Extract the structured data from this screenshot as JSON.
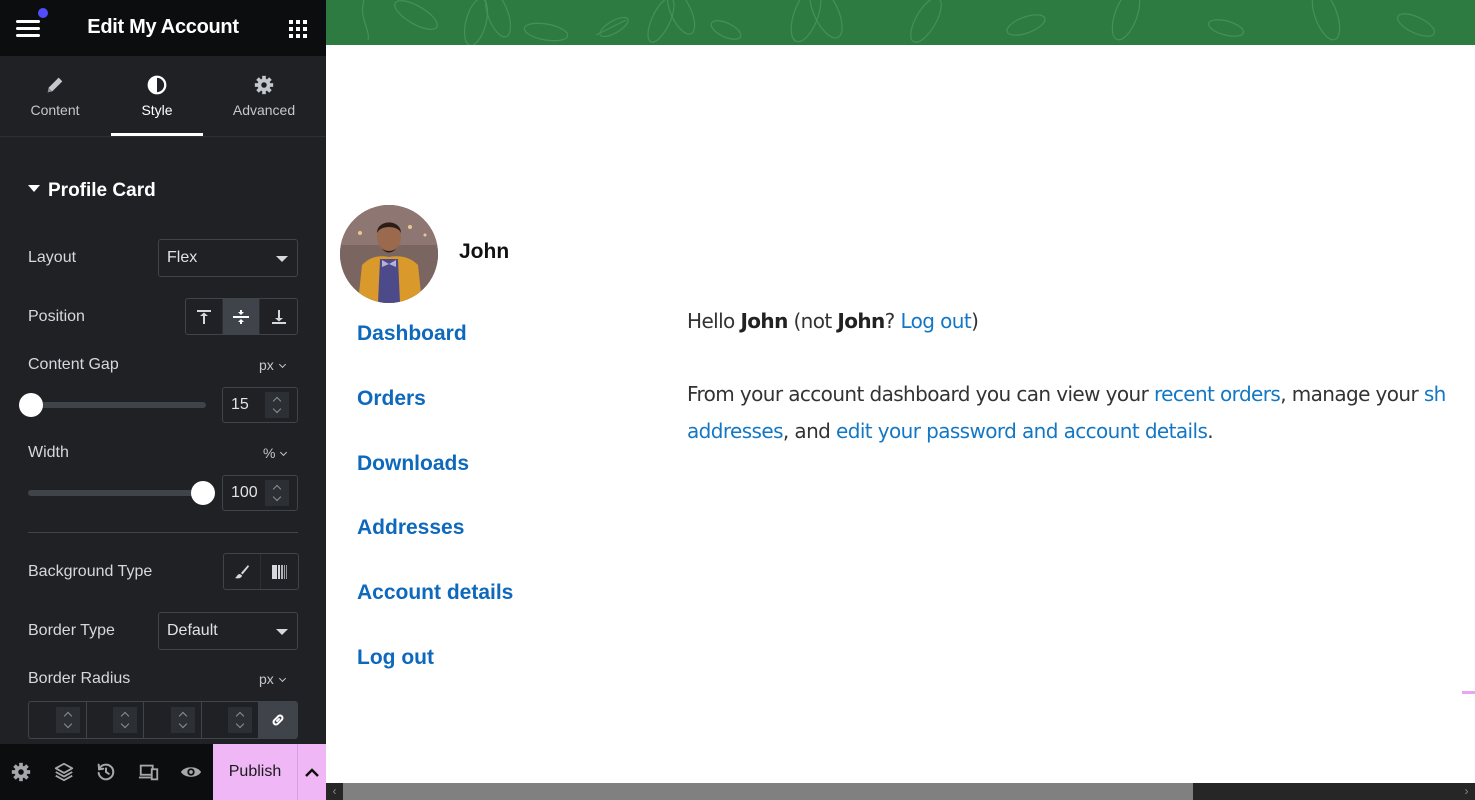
{
  "panel": {
    "title": "Edit My Account",
    "menu_icon": "hamburger-icon",
    "apps_icon": "grid-icon",
    "tabs": [
      {
        "label": "Content",
        "icon": "pencil-icon",
        "active": false
      },
      {
        "label": "Style",
        "icon": "contrast-icon",
        "active": true
      },
      {
        "label": "Advanced",
        "icon": "gear-icon",
        "active": false
      }
    ],
    "section": {
      "title": "Profile Card",
      "controls": {
        "layout": {
          "label": "Layout",
          "value": "Flex"
        },
        "position": {
          "label": "Position",
          "options": [
            "top",
            "middle",
            "bottom"
          ],
          "selected": "middle"
        },
        "content_gap": {
          "label": "Content Gap",
          "unit": "px",
          "value": "15",
          "slider_fraction": 0.0
        },
        "width": {
          "label": "Width",
          "unit": "%",
          "value": "100",
          "slider_fraction": 1.0
        },
        "background_type": {
          "label": "Background Type",
          "options": [
            "classic",
            "gradient"
          ]
        },
        "border_type": {
          "label": "Border Type",
          "value": "Default"
        },
        "border_radius": {
          "label": "Border Radius",
          "unit": "px",
          "values": [
            "",
            "",
            "",
            ""
          ],
          "linked": true
        }
      }
    },
    "footer": {
      "icons": [
        "settings-icon",
        "layers-icon",
        "history-icon",
        "responsive-icon",
        "preview-eye-icon"
      ],
      "publish_label": "Publish"
    }
  },
  "preview": {
    "profile": {
      "name": "John"
    },
    "nav": [
      "Dashboard",
      "Orders",
      "Downloads",
      "Addresses",
      "Account details",
      "Log out"
    ],
    "greeting": {
      "hello": "Hello ",
      "name": "John",
      "not": " (not ",
      "name2": "John",
      "q": "? ",
      "logout_link": "Log out",
      "close": ")"
    },
    "intro": {
      "part1": "From your account dashboard you can view your ",
      "link1": "recent orders",
      "part2": ", manage your ",
      "link2": "sh",
      "link3": "addresses",
      "part3": ", and ",
      "link4": "edit your password and account details",
      "part4": "."
    }
  },
  "colors": {
    "panel_bg": "#1f2124",
    "topbar_bg": "#0c0d0e",
    "publish_bg": "#f0b7f7",
    "banner_green": "#2e7b41",
    "link_blue": "#0e69bd",
    "notification_dot": "#524cff"
  }
}
